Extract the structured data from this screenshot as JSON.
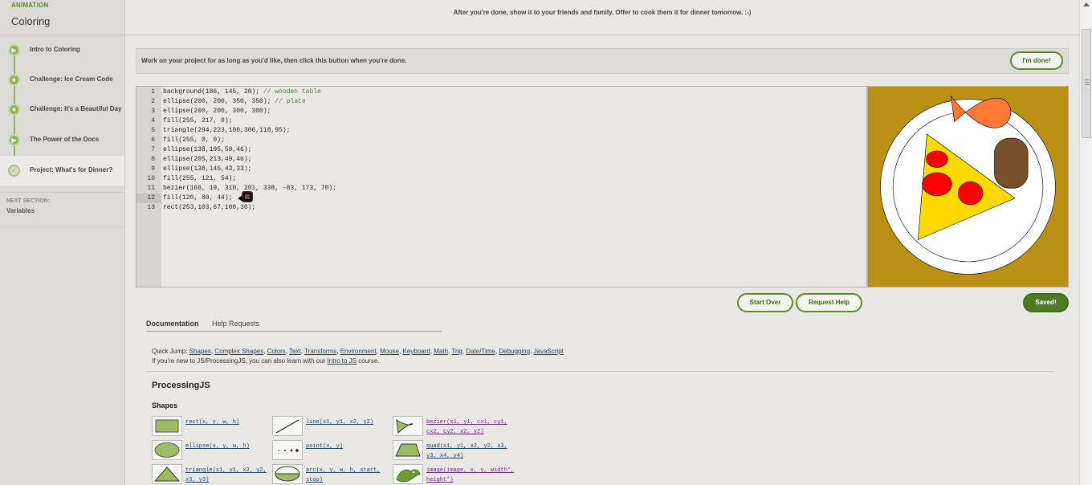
{
  "sidebar": {
    "section_label": "ANIMATION",
    "section_title": "Coloring",
    "items": [
      {
        "label": "Intro to Coloring",
        "icon": "play-icon"
      },
      {
        "label": "Challenge: Ice Cream Code",
        "icon": "star-icon"
      },
      {
        "label": "Challenge: It's a Beautiful Day",
        "icon": "star-icon"
      },
      {
        "label": "The Power of the Docs",
        "icon": "play-icon"
      },
      {
        "label": "Project: What's for Dinner?",
        "icon": "check-icon"
      }
    ],
    "next_label": "NEXT SECTION:",
    "next_title": "Variables"
  },
  "top_instruction": "After you're done, show it to your friends and family. Offer to cook them it for dinner tomorrow. :-)",
  "project_bar": {
    "message": "Work on your project for as long as you'd like, then click this button when you're done.",
    "done_label": "I'm done!"
  },
  "editor": {
    "active_line": 12,
    "lines": [
      {
        "num": "1",
        "code": "background(186, 145, 20); ",
        "comment": "// wooden table"
      },
      {
        "num": "2",
        "code": "ellipse(200, 200, 350, 350); ",
        "comment": "// plate"
      },
      {
        "num": "3",
        "code": "ellipse(200, 200, 300, 300);",
        "comment": ""
      },
      {
        "num": "4",
        "code": "fill(255, 217, 0);",
        "comment": ""
      },
      {
        "num": "5",
        "code": "triangle(294,223,100,306,118,95);",
        "comment": ""
      },
      {
        "num": "6",
        "code": "fill(255, 0, 0);",
        "comment": ""
      },
      {
        "num": "7",
        "code": "ellipse(138,195,59,46);",
        "comment": ""
      },
      {
        "num": "8",
        "code": "ellipse(205,213,49,46);",
        "comment": ""
      },
      {
        "num": "9",
        "code": "ellipse(138,145,43,33);",
        "comment": ""
      },
      {
        "num": "10",
        "code": "fill(255, 121, 54);",
        "comment": ""
      },
      {
        "num": "11",
        "code": "bezier(166, 19, 310, 201, 338, -83, 173, 70);",
        "comment": ""
      },
      {
        "num": "12",
        "code": "fill(120, 80, 44);",
        "comment": ""
      },
      {
        "num": "13",
        "code": "rect(253,103,67,100,30);",
        "comment": ""
      }
    ]
  },
  "colors": {
    "table": "#ba9114",
    "plate": "#ffffff",
    "cheese": "#ffd900",
    "pepperoni": "#ff0000",
    "fish": "#ff7936",
    "drink": "#78502c",
    "accent": "#5b8a2a"
  },
  "actions": {
    "start_over": "Start Over",
    "request_help": "Request Help",
    "saved": "Saved!"
  },
  "docs": {
    "tabs": [
      "Documentation",
      "Help Requests"
    ],
    "quick_jump_label": "Quick Jump:",
    "quick_jump": [
      "Shapes",
      "Complex Shapes",
      "Colors",
      "Text",
      "Transforms",
      "Environment",
      "Mouse",
      "Keyboard",
      "Math",
      "Trig",
      "Date/Time",
      "Debugging",
      "JavaScript"
    ],
    "new_to_prefix": "If you're new to JS/ProcessingJS, you can also learn with our",
    "new_to_link": "Intro to JS",
    "new_to_suffix": "course.",
    "section_title": "ProcessingJS",
    "subsection": "Shapes",
    "shapes": [
      {
        "name": "rect-doc",
        "sig": "rect(x, y, w, h)"
      },
      {
        "name": "line-doc",
        "sig": "line(x1, y1, x2, y2)"
      },
      {
        "name": "bezier-doc",
        "sig": "bezier(x1, y1, cx1, cy1,\ncx2, cy2, x2, y2)"
      },
      {
        "name": "ellipse-doc",
        "sig": "ellipse(x, y, w, h)"
      },
      {
        "name": "point-doc",
        "sig": "point(x, y)"
      },
      {
        "name": "quad-doc",
        "sig": "quad(x1, y1, x2, y2, x3,\ny3, x4, y4)"
      },
      {
        "name": "triangle-doc",
        "sig": "triangle(x1, y1, x2, y2,\nx3, y3)"
      },
      {
        "name": "arc-doc",
        "sig": "arc(x, y, w, h, start,\nstop)"
      },
      {
        "name": "image-doc",
        "sig": "image(image, x, y, width*,\nheight*)"
      }
    ]
  }
}
